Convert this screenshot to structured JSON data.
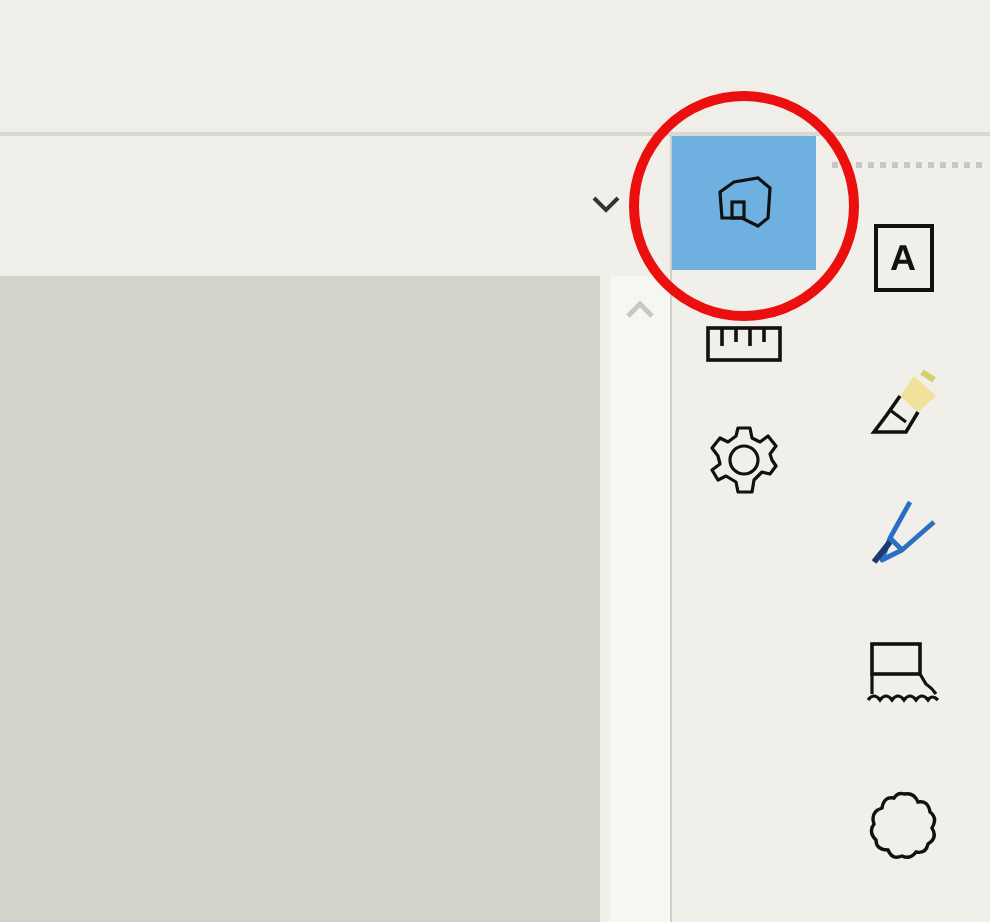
{
  "tool_columns": [
    {
      "tools": [
        {
          "kind": "shape",
          "selected": true
        },
        {
          "kind": "ruler",
          "selected": false
        },
        {
          "kind": "settings",
          "selected": false
        }
      ]
    },
    {
      "tools": [
        {
          "kind": "text",
          "glyph": "A",
          "selected": false
        },
        {
          "kind": "highlighter",
          "selected": false
        },
        {
          "kind": "pen",
          "selected": false
        },
        {
          "kind": "box-wave",
          "selected": false
        },
        {
          "kind": "flower",
          "selected": false
        }
      ]
    }
  ]
}
